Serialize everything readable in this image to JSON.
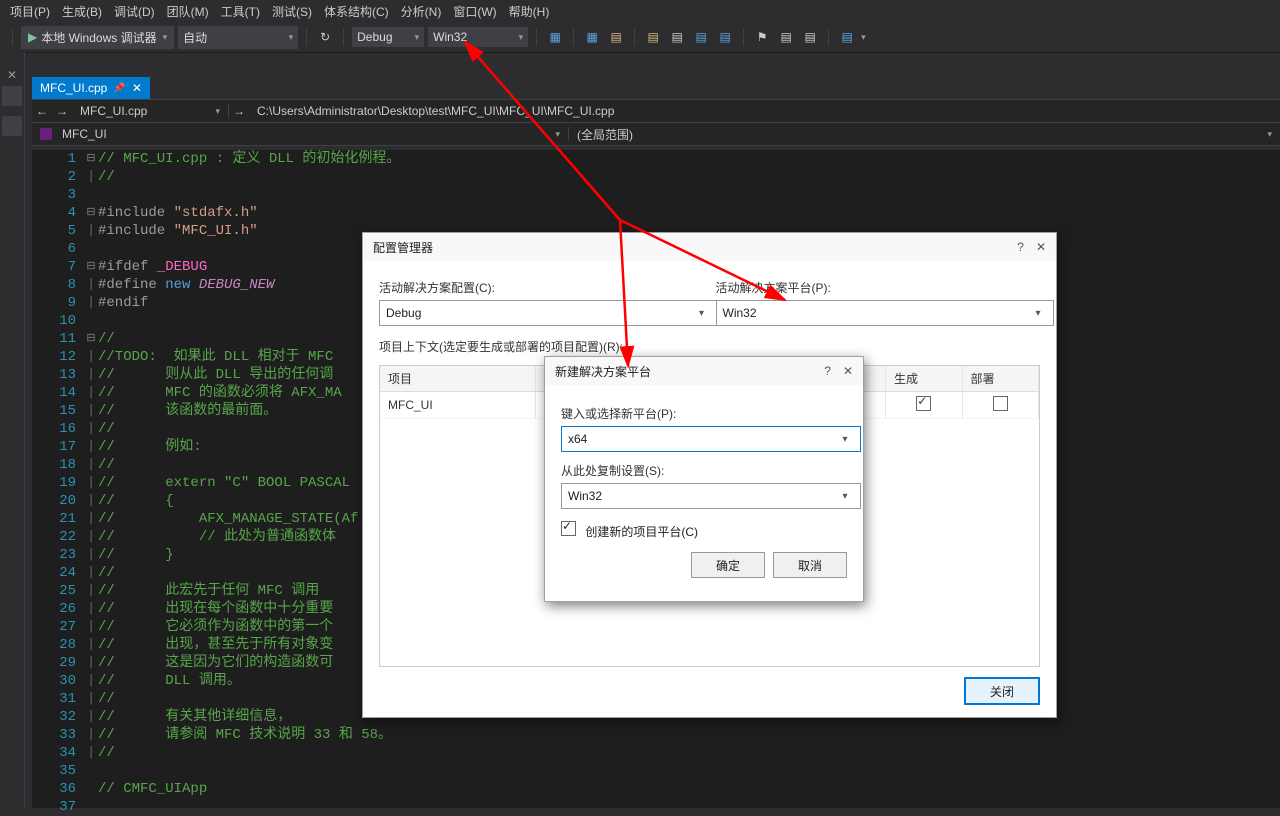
{
  "menu": {
    "items": [
      "项目(P)",
      "生成(B)",
      "调试(D)",
      "团队(M)",
      "工具(T)",
      "测试(S)",
      "体系结构(C)",
      "分析(N)",
      "窗口(W)",
      "帮助(H)"
    ]
  },
  "toolbar": {
    "debugger_label": "本地 Windows 调试器",
    "startup_combo": "自动",
    "config_combo": "Debug",
    "platform_combo": "Win32"
  },
  "tab": {
    "filename": "MFC_UI.cpp"
  },
  "nav": {
    "file_left": "MFC_UI.cpp",
    "file_path": "C:\\Users\\Administrator\\Desktop\\test\\MFC_UI\\MFC_UI\\MFC_UI.cpp",
    "project": "MFC_UI",
    "scope": "(全局范围)"
  },
  "code": {
    "lines": [
      {
        "n": "1",
        "fold": "⊟",
        "cls": "c-green",
        "t": "// MFC_UI.cpp : 定义 DLL 的初始化例程。"
      },
      {
        "n": "2",
        "fold": "|",
        "cls": "c-green",
        "t": "//"
      },
      {
        "n": "3",
        "fold": "",
        "cls": "",
        "t": ""
      },
      {
        "n": "4",
        "fold": "⊟",
        "cls": "",
        "t": "",
        "parts": [
          {
            "cls": "c-gray",
            "t": "#include "
          },
          {
            "cls": "c-string",
            "t": "\"stdafx.h\""
          }
        ]
      },
      {
        "n": "5",
        "fold": "|",
        "cls": "",
        "t": "",
        "parts": [
          {
            "cls": "c-gray",
            "t": "#include "
          },
          {
            "cls": "c-string",
            "t": "\"MFC_UI.h\""
          }
        ]
      },
      {
        "n": "6",
        "fold": "",
        "cls": "",
        "t": ""
      },
      {
        "n": "7",
        "fold": "⊟",
        "cls": "",
        "t": "",
        "parts": [
          {
            "cls": "c-gray",
            "t": "#ifdef "
          },
          {
            "cls": "c-pink",
            "t": "_DEBUG"
          }
        ]
      },
      {
        "n": "8",
        "fold": "|",
        "cls": "",
        "t": "",
        "parts": [
          {
            "cls": "c-gray",
            "t": "#define "
          },
          {
            "cls": "c-blue",
            "t": "new "
          },
          {
            "cls": "c-purple c-italic",
            "t": "DEBUG_NEW"
          }
        ]
      },
      {
        "n": "9",
        "fold": "|",
        "cls": "c-gray",
        "t": "#endif"
      },
      {
        "n": "10",
        "fold": "",
        "cls": "",
        "t": ""
      },
      {
        "n": "11",
        "fold": "⊟",
        "cls": "c-green",
        "t": "//"
      },
      {
        "n": "12",
        "fold": "|",
        "cls": "c-green",
        "t": "//TODO:  如果此 DLL 相对于 MFC"
      },
      {
        "n": "13",
        "fold": "|",
        "cls": "c-green",
        "t": "//      则从此 DLL 导出的任何调"
      },
      {
        "n": "14",
        "fold": "|",
        "cls": "c-green",
        "t": "//      MFC 的函数必须将 AFX_MA"
      },
      {
        "n": "15",
        "fold": "|",
        "cls": "c-green",
        "t": "//      该函数的最前面。"
      },
      {
        "n": "16",
        "fold": "|",
        "cls": "c-green",
        "t": "//"
      },
      {
        "n": "17",
        "fold": "|",
        "cls": "c-green",
        "t": "//      例如: "
      },
      {
        "n": "18",
        "fold": "|",
        "cls": "c-green",
        "t": "//"
      },
      {
        "n": "19",
        "fold": "|",
        "cls": "c-green",
        "t": "//      extern \"C\" BOOL PASCAL"
      },
      {
        "n": "20",
        "fold": "|",
        "cls": "c-green",
        "t": "//      {"
      },
      {
        "n": "21",
        "fold": "|",
        "cls": "c-green",
        "t": "//          AFX_MANAGE_STATE(Af"
      },
      {
        "n": "22",
        "fold": "|",
        "cls": "c-green",
        "t": "//          // 此处为普通函数体"
      },
      {
        "n": "23",
        "fold": "|",
        "cls": "c-green",
        "t": "//      }"
      },
      {
        "n": "24",
        "fold": "|",
        "cls": "c-green",
        "t": "//"
      },
      {
        "n": "25",
        "fold": "|",
        "cls": "c-green",
        "t": "//      此宏先于任何 MFC 调用"
      },
      {
        "n": "26",
        "fold": "|",
        "cls": "c-green",
        "t": "//      出现在每个函数中十分重要"
      },
      {
        "n": "27",
        "fold": "|",
        "cls": "c-green",
        "t": "//      它必须作为函数中的第一个"
      },
      {
        "n": "28",
        "fold": "|",
        "cls": "c-green",
        "t": "//      出现，甚至先于所有对象变"
      },
      {
        "n": "29",
        "fold": "|",
        "cls": "c-green",
        "t": "//      这是因为它们的构造函数可"
      },
      {
        "n": "30",
        "fold": "|",
        "cls": "c-green",
        "t": "//      DLL 调用。"
      },
      {
        "n": "31",
        "fold": "|",
        "cls": "c-green",
        "t": "//"
      },
      {
        "n": "32",
        "fold": "|",
        "cls": "c-green",
        "t": "//      有关其他详细信息，"
      },
      {
        "n": "33",
        "fold": "|",
        "cls": "c-green",
        "t": "//      请参阅 MFC 技术说明 33 和 58。"
      },
      {
        "n": "34",
        "fold": "|",
        "cls": "c-green",
        "t": "//"
      },
      {
        "n": "35",
        "fold": "",
        "cls": "",
        "t": ""
      },
      {
        "n": "36",
        "fold": "",
        "cls": "c-green",
        "t": "// CMFC_UIApp"
      },
      {
        "n": "37",
        "fold": "",
        "cls": "",
        "t": ""
      }
    ]
  },
  "config_dialog": {
    "title": "配置管理器",
    "active_config_label": "活动解决方案配置(C):",
    "active_config_value": "Debug",
    "active_platform_label": "活动解决方案平台(P):",
    "active_platform_value": "Win32",
    "context_label": "项目上下文(选定要生成或部署的项目配置)(R):",
    "columns": {
      "project": "项目",
      "config": "",
      "platform": "",
      "build": "生成",
      "deploy": "部署"
    },
    "row": {
      "project": "MFC_UI",
      "build": true,
      "deploy": false
    },
    "close_label": "关闭"
  },
  "platform_dialog": {
    "title": "新建解决方案平台",
    "new_platform_label": "键入或选择新平台(P):",
    "new_platform_value": "x64",
    "copy_from_label": "从此处复制设置(S):",
    "copy_from_value": "Win32",
    "create_proj_label": "创建新的项目平台(C)",
    "create_proj_checked": true,
    "ok_label": "确定",
    "cancel_label": "取消"
  }
}
